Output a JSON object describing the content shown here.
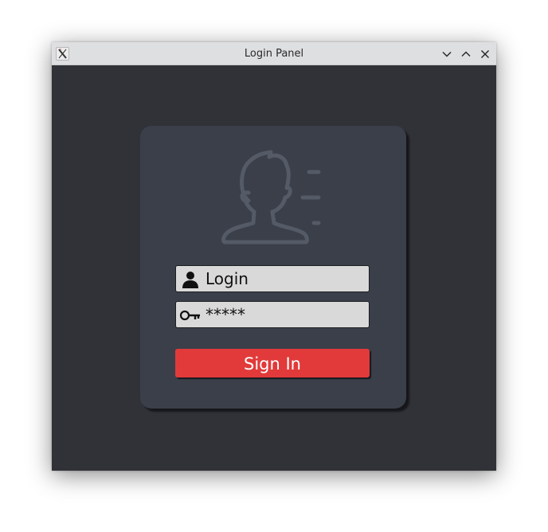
{
  "window": {
    "title": "Login Panel",
    "controls": [
      "minimize",
      "maximize",
      "close"
    ]
  },
  "form": {
    "login_placeholder": "Login",
    "password_value": "*****",
    "signin_label": "Sign In"
  },
  "icons": {
    "app": "x11-app-icon",
    "avatar": "user-profile-outline-icon",
    "login_field": "user-icon",
    "password_field": "key-icon"
  },
  "colors": {
    "window_bg": "#313238",
    "card_bg": "#3a3f4a",
    "field_bg": "#d9d9d9",
    "signin_bg": "#e23a3a",
    "avatar_stroke": "#545a66"
  }
}
